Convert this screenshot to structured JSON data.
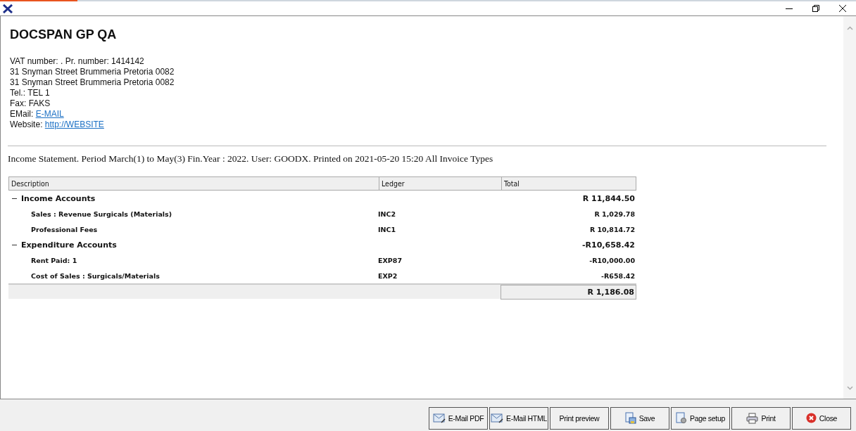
{
  "company": {
    "name": "DOCSPAN GP QA",
    "lines": [
      "VAT number: . Pr. number: 1414142",
      "31 Snyman Street Brummeria Pretoria 0082",
      "31 Snyman Street Brummeria Pretoria 0082",
      "Tel.: TEL 1",
      "Fax: FAKS"
    ],
    "email": {
      "label": "EMail:",
      "link": "E-MAIL"
    },
    "website": {
      "label": "Website:",
      "link": "http://WEBSITE"
    }
  },
  "report_title": "Income Statement. Period March(1) to May(3) Fin.Year : 2022. User: GOODX. Printed on 2021-05-20 15:20 All Invoice Types",
  "table": {
    "columns": [
      "Description",
      "Ledger",
      "Total"
    ],
    "groups": [
      {
        "name": "Income Accounts",
        "total": "R 11,844.50",
        "expanded": true,
        "children": [
          {
            "description": "Sales : Revenue Surgicals (Materials)",
            "ledger": "INC2",
            "total": "R 1,029.78"
          },
          {
            "description": "Professional Fees",
            "ledger": "INC1",
            "total": "R 10,814.72"
          }
        ]
      },
      {
        "name": "Expenditure Accounts",
        "total": "-R10,658.42",
        "expanded": true,
        "children": [
          {
            "description": "Rent Paid: 1",
            "ledger": "EXP87",
            "total": "-R10,000.00"
          },
          {
            "description": "Cost of Sales : Surgicals/Materials",
            "ledger": "EXP2",
            "total": "-R658.42"
          }
        ]
      }
    ],
    "grand_total": "R 1,186.08"
  },
  "buttons": [
    {
      "label": "E-Mail PDF",
      "kind": "email"
    },
    {
      "label": "E-Mail HTML",
      "kind": "email"
    },
    {
      "label": "Print preview",
      "kind": "plain"
    },
    {
      "label": "Save",
      "kind": "save"
    },
    {
      "label": "Page setup",
      "kind": "page"
    },
    {
      "label": "Print",
      "kind": "print"
    },
    {
      "label": "Close",
      "kind": "close"
    }
  ]
}
